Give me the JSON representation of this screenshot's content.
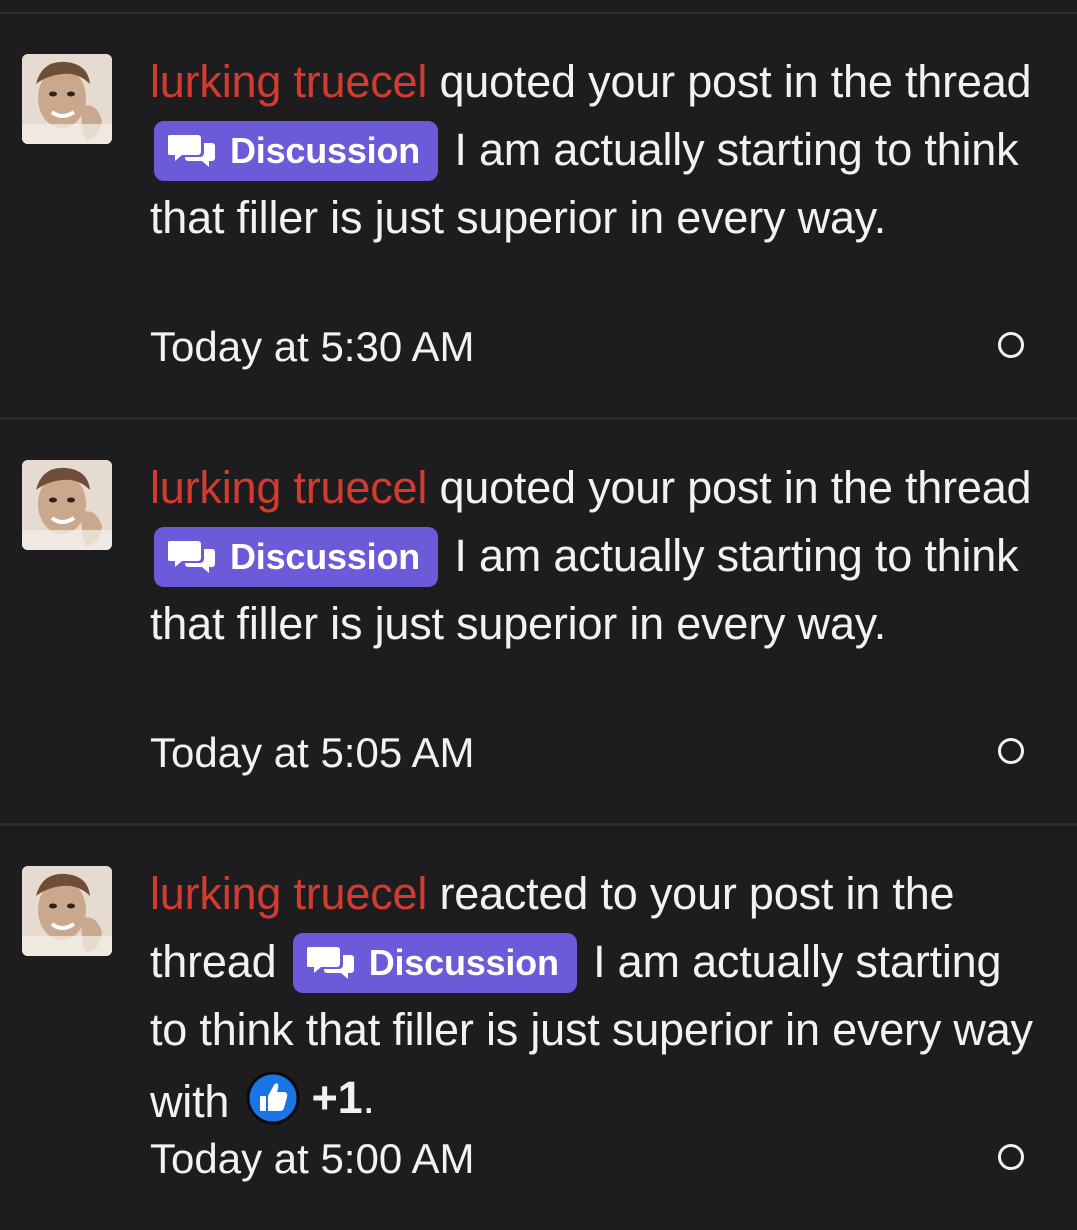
{
  "colors": {
    "background": "#1d1d1f",
    "username": "#d23b2f",
    "badge": "#6c5bd8",
    "text": "#f2f2f2",
    "like": "#1b74e4"
  },
  "notifications": [
    {
      "username": "lurking truecel",
      "action": " quoted your post in the thread ",
      "badge_label": "Discussion",
      "badge_icon": "chat-bubbles-icon",
      "thread_title": " I am actually starting to think that filler is just superior in every way.",
      "timestamp": "Today at 5:30 AM",
      "avatar_icon": "user-avatar"
    },
    {
      "username": "lurking truecel",
      "action": " quoted your post in the thread ",
      "badge_label": "Discussion",
      "badge_icon": "chat-bubbles-icon",
      "thread_title": " I am actually starting to think that filler is just superior in every way.",
      "timestamp": "Today at 5:05 AM",
      "avatar_icon": "user-avatar"
    },
    {
      "username": "lurking truecel",
      "action": " reacted to your post in the thread ",
      "badge_label": "Discussion",
      "badge_icon": "chat-bubbles-icon",
      "thread_title": " I am actually starting to think that filler is just superior in every way with ",
      "reaction_icon": "thumbs-up-icon",
      "reaction_count": "+1",
      "reaction_suffix": ".",
      "timestamp": "Today at 5:00 AM",
      "avatar_icon": "user-avatar"
    }
  ]
}
